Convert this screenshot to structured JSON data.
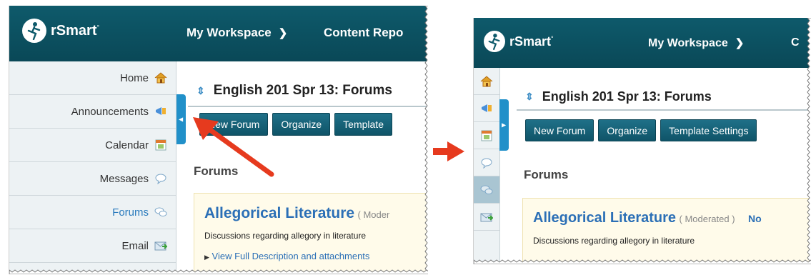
{
  "header": {
    "brand": "rSmart",
    "brand_mark": "°",
    "workspace_label": "My Workspace",
    "content_label": "Content Repo",
    "content_label_right": "C"
  },
  "sidebar": {
    "items": [
      {
        "label": "Home",
        "icon": "home-icon"
      },
      {
        "label": "Announcements",
        "icon": "megaphone-icon"
      },
      {
        "label": "Calendar",
        "icon": "calendar-icon"
      },
      {
        "label": "Messages",
        "icon": "speech-bubble-icon"
      },
      {
        "label": "Forums",
        "icon": "forum-bubbles-icon",
        "active": true
      },
      {
        "label": "Email",
        "icon": "mail-icon"
      }
    ]
  },
  "page": {
    "title": "English 201 Spr 13: Forums",
    "title_cropped": "English 201 Spr 13: Forums"
  },
  "toolbar": {
    "new_forum": "New Forum",
    "organize": "Organize",
    "template_settings": "Template Settings",
    "template_cropped": "Template"
  },
  "forums": {
    "heading": "Forums",
    "forum_title": "Allegorical Literature",
    "status": "( Moderated )",
    "status_cropped": "( Moder",
    "extra_right": "No",
    "description": "Discussions regarding allegory in literature",
    "view_link": "View Full Description and attachments"
  },
  "colors": {
    "header_bg": "#0e5a6b",
    "accent_blue": "#2190c9",
    "arrow_red": "#e63a1e",
    "forum_title": "#2b6fb6",
    "forum_card_bg": "#fffbea"
  }
}
